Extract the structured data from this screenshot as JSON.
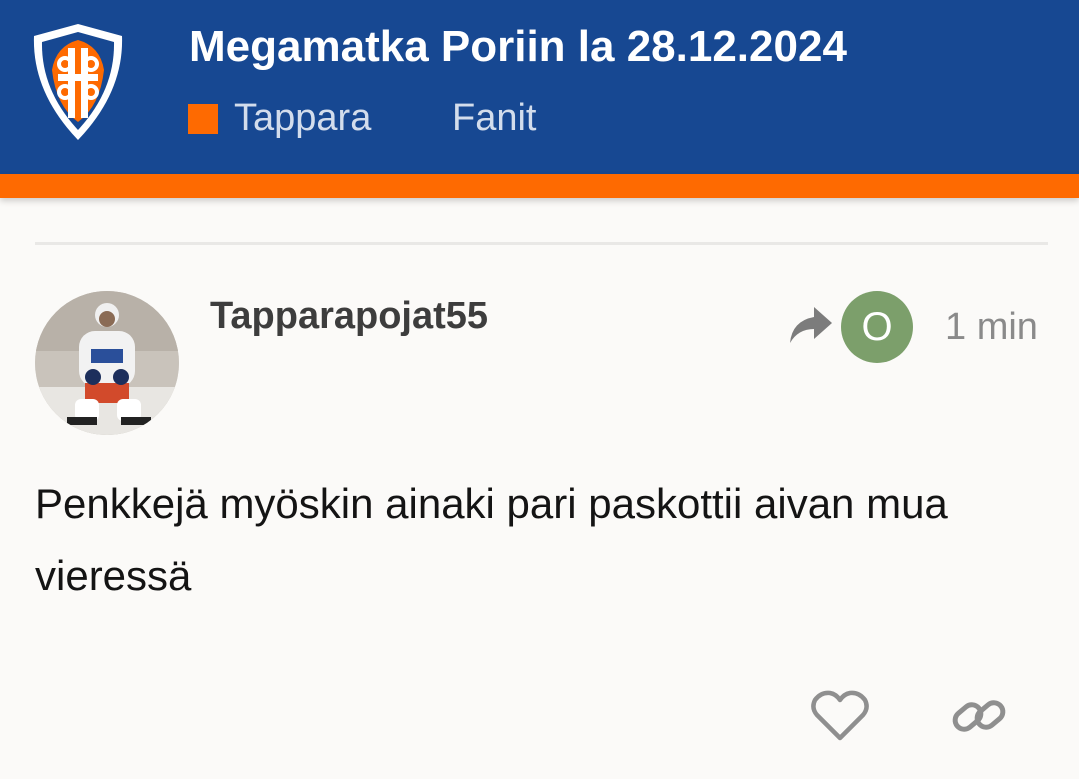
{
  "header": {
    "topic_title": "Megamatka Poriin la 28.12.2024",
    "category_label": "Tappara",
    "tag_label": "Fanit",
    "colors": {
      "header_bg": "#174892",
      "accent": "#fe6a01"
    }
  },
  "post": {
    "username": "Tapparapojat55",
    "reply_to_avatar_letter": "O",
    "reply_to_avatar_color": "#7c9f6b",
    "age": "1 min",
    "body": "Penkkejä myöskin ainaki pari paskottii aivan mua vieressä"
  },
  "actions": {
    "like_icon": "heart-icon",
    "share_icon": "link-icon"
  }
}
